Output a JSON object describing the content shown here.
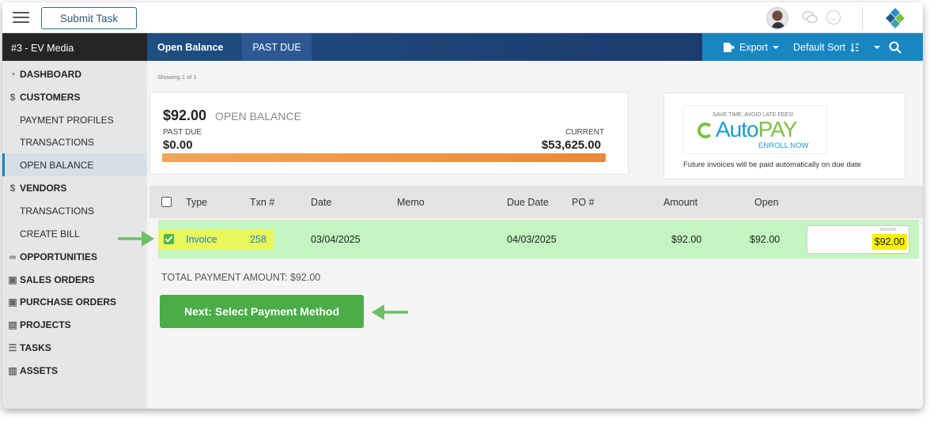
{
  "topbar": {
    "submit_task_label": "Submit Task"
  },
  "nav": {
    "company": "#3 - EV Media",
    "tabs": [
      {
        "label": "Open Balance"
      },
      {
        "label": "PAST DUE"
      }
    ],
    "export_label": "Export",
    "sort_label": "Default Sort"
  },
  "sidebar": {
    "items": [
      {
        "label": "DASHBOARD",
        "icon": "dashboard-icon"
      },
      {
        "label": "CUSTOMERS",
        "icon": "dollar-icon"
      },
      {
        "label": "PAYMENT PROFILES"
      },
      {
        "label": "TRANSACTIONS"
      },
      {
        "label": "OPEN BALANCE"
      },
      {
        "label": "VENDORS",
        "icon": "dollar-icon"
      },
      {
        "label": "TRANSACTIONS"
      },
      {
        "label": "CREATE BILL"
      },
      {
        "label": "OPPORTUNITIES",
        "icon": "binoculars-icon"
      },
      {
        "label": "SALES ORDERS",
        "icon": "order-icon"
      },
      {
        "label": "PURCHASE ORDERS",
        "icon": "order-icon"
      },
      {
        "label": "PROJECTS",
        "icon": "clipboard-icon"
      },
      {
        "label": "TASKS",
        "icon": "tasks-icon"
      },
      {
        "label": "ASSETS",
        "icon": "assets-icon"
      }
    ]
  },
  "main": {
    "showing": "Showing 1 of 1",
    "balance": {
      "amount": "$92.00",
      "label": "OPEN BALANCE",
      "past_due_label": "PAST DUE",
      "past_due_value": "$0.00",
      "current_label": "CURRENT",
      "current_value": "$53,625.00"
    },
    "autopay": {
      "tagline": "SAVE TIME, AVOID LATE FEES!",
      "word_a": "Auto",
      "word_b": "PAY",
      "enroll": "ENROLL NOW",
      "note": "Future invoices will be paid automatically on due date"
    },
    "table": {
      "headers": {
        "type": "Type",
        "txn": "Txn #",
        "date": "Date",
        "memo": "Memo",
        "due": "Due Date",
        "po": "PO #",
        "amount": "Amount",
        "open": "Open"
      },
      "row": {
        "type": "Invoice",
        "txn": "258",
        "date": "03/04/2025",
        "memo": "",
        "due": "04/03/2025",
        "po": "",
        "amount": "$92.00",
        "open": "$92.00",
        "input_label": "Amount",
        "input_value": "$92.00"
      }
    },
    "total": "TOTAL PAYMENT AMOUNT: $92.00",
    "next_button": "Next: Select Payment Method"
  },
  "colors": {
    "accent_blue": "#1886c1",
    "row_green": "#c2f5c0",
    "button_green": "#4aad48",
    "highlight_yellow": "#f7f100",
    "bar_orange": "#e9893a"
  }
}
